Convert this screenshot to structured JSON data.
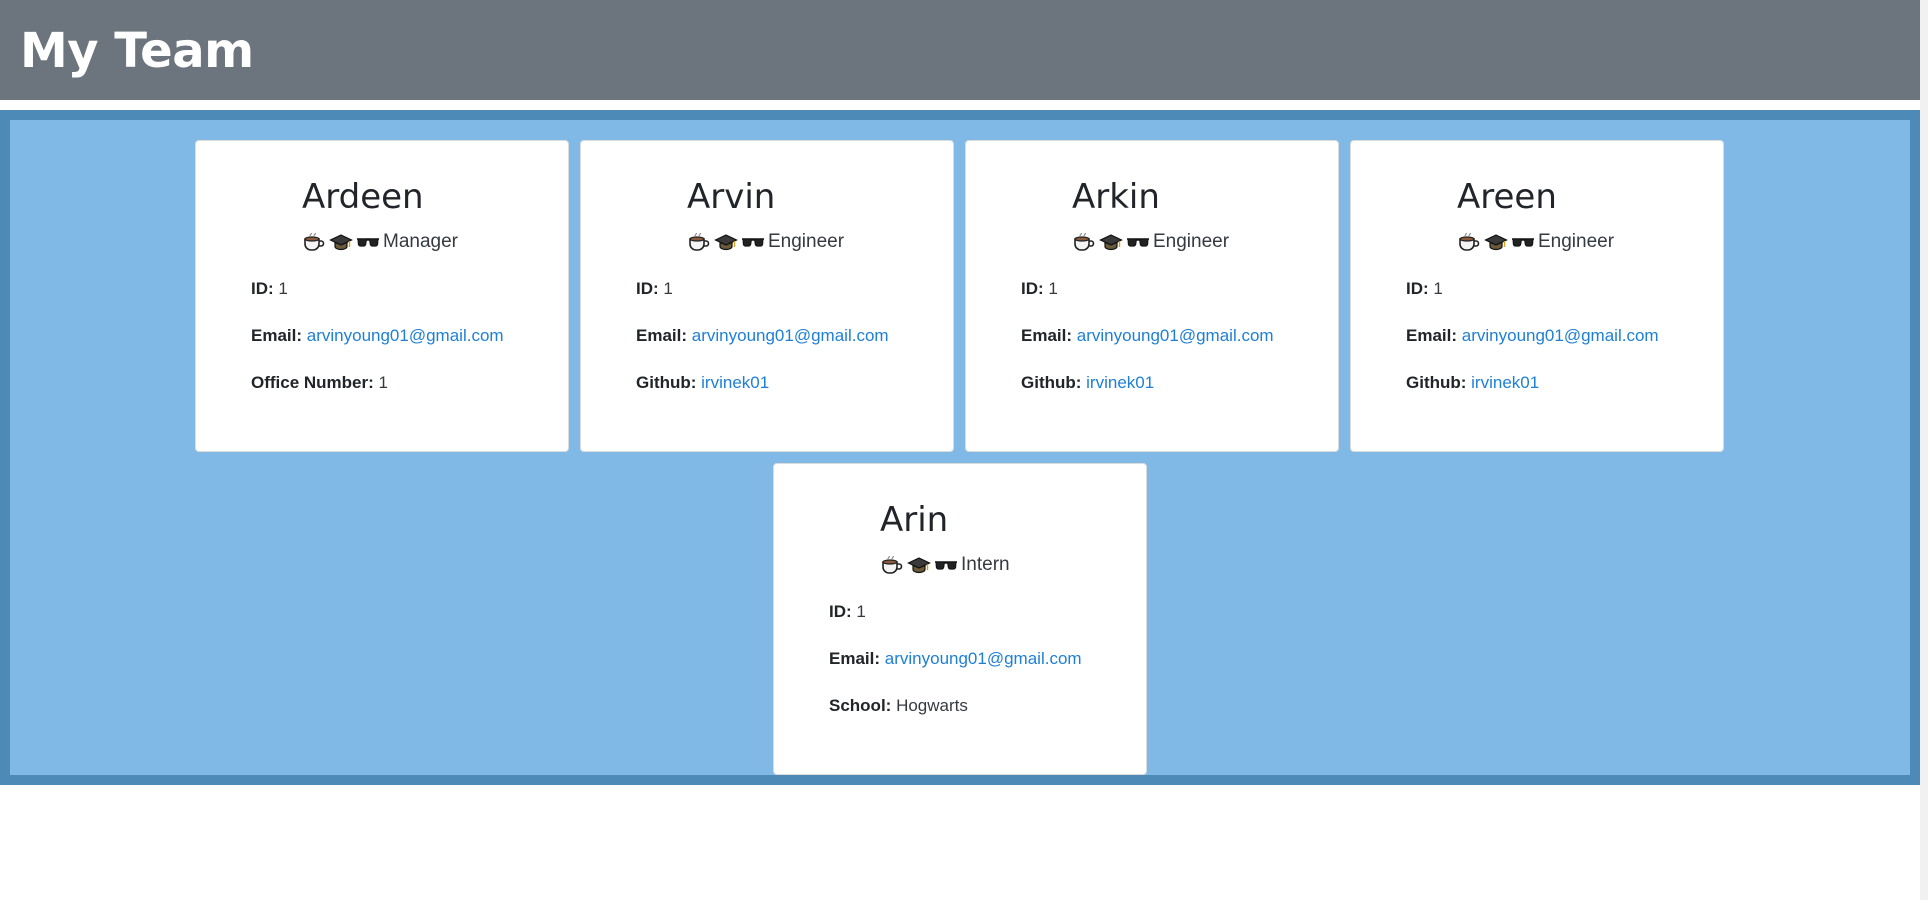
{
  "header": {
    "title": "My Team"
  },
  "icons": [
    "coffee-icon",
    "graduation-cap-icon",
    "sunglasses-icon"
  ],
  "labels": {
    "id": "ID:",
    "email": "Email:",
    "office": "Office Number:",
    "github": "Github:",
    "school": "School:"
  },
  "members": [
    {
      "name": "Ardeen",
      "role": "Manager",
      "id": "1",
      "email": "arvinyoung01@gmail.com",
      "extra_label": "Office Number:",
      "extra_value": "1"
    },
    {
      "name": "Arvin",
      "role": "Engineer",
      "id": "1",
      "email": "arvinyoung01@gmail.com",
      "extra_label": "Github:",
      "extra_value": "irvinek01"
    },
    {
      "name": "Arkin",
      "role": "Engineer",
      "id": "1",
      "email": "arvinyoung01@gmail.com",
      "extra_label": "Github:",
      "extra_value": "irvinek01"
    },
    {
      "name": "Areen",
      "role": "Engineer",
      "id": "1",
      "email": "arvinyoung01@gmail.com",
      "extra_label": "Github:",
      "extra_value": "irvinek01"
    },
    {
      "name": "Arin",
      "role": "Intern",
      "id": "1",
      "email": "arvinyoung01@gmail.com",
      "extra_label": "School:",
      "extra_value": "Hogwarts"
    }
  ],
  "colors": {
    "header_bg": "#6c757d",
    "band_border": "#4e8ab8",
    "band_bg": "#80b9e5",
    "link": "#1e7fd6"
  }
}
